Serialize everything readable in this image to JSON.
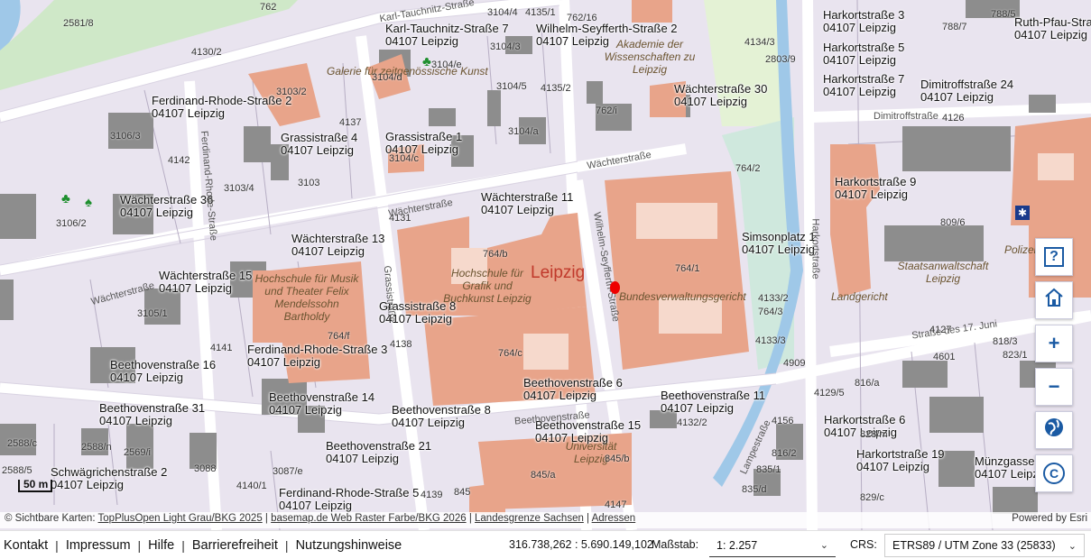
{
  "map": {
    "city_label": "Leipzig",
    "addresses": [
      {
        "street": "Karl-Tauchnitz-Straße 7",
        "zip": "04107 Leipzig"
      },
      {
        "street": "Wilhelm-Seyfferth-Straße 2",
        "zip": "04107 Leipzig"
      },
      {
        "street": "Harkortstraße 3",
        "zip": "04107 Leipzig"
      },
      {
        "street": "Ruth-Pfau-Straße",
        "zip": "04107 Leipzig"
      },
      {
        "street": "Harkortstraße 5",
        "zip": "04107 Leipzig"
      },
      {
        "street": "Harkortstraße 7",
        "zip": "04107 Leipzig"
      },
      {
        "street": "Dimitroffstraße 24",
        "zip": "04107 Leipzig"
      },
      {
        "street": "Ferdinand-Rhode-Straße 2",
        "zip": "04107 Leipzig"
      },
      {
        "street": "Wächterstraße 30",
        "zip": "04107 Leipzig"
      },
      {
        "street": "Grassistraße 4",
        "zip": "04107 Leipzig"
      },
      {
        "street": "Grassistraße 1",
        "zip": "04107 Leipzig"
      },
      {
        "street": "Harkortstraße 9",
        "zip": "04107 Leipzig"
      },
      {
        "street": "Wächterstraße 36",
        "zip": "04107 Leipzig"
      },
      {
        "street": "Wächterstraße 11",
        "zip": "04107 Leipzig"
      },
      {
        "street": "Simsonplatz 1",
        "zip": "04107 Leipzig"
      },
      {
        "street": "Wächterstraße 13",
        "zip": "04107 Leipzig"
      },
      {
        "street": "Wächterstraße 15",
        "zip": "04107 Leipzig"
      },
      {
        "street": "Grassistraße 8",
        "zip": "04107 Leipzig"
      },
      {
        "street": "Ferdinand-Rhode-Straße 3",
        "zip": "04107 Leipzig"
      },
      {
        "street": "Beethovenstraße 16",
        "zip": "04107 Leipzig"
      },
      {
        "street": "Beethovenstraße 6",
        "zip": "04107 Leipzig"
      },
      {
        "street": "Beethovenstraße 11",
        "zip": "04107 Leipzig"
      },
      {
        "street": "Beethovenstraße 14",
        "zip": "04107 Leipzig"
      },
      {
        "street": "Beethovenstraße 31",
        "zip": "04107 Leipzig"
      },
      {
        "street": "Beethovenstraße 8",
        "zip": "04107 Leipzig"
      },
      {
        "street": "Beethovenstraße 15",
        "zip": "04107 Leipzig"
      },
      {
        "street": "Harkortstraße 6",
        "zip": "04107 Leipzig"
      },
      {
        "street": "Beethovenstraße 21",
        "zip": "04107 Leipzig"
      },
      {
        "street": "Harkortstraße 19",
        "zip": "04107 Leipzig"
      },
      {
        "street": "Schwägrichenstraße 2",
        "zip": "04107 Leipzig"
      },
      {
        "street": "Münzgasse",
        "zip": "04107 Leipzig"
      },
      {
        "street": "Ferdinand-Rhode-Straße 5",
        "zip": "04107 Leipzig"
      }
    ],
    "pois": [
      "Galerie für zeitgenössische Kunst",
      "Akademie der Wissenschaften zu Leipzig",
      "Hochschule für Grafik und Buchkunst Leipzig",
      "Bundesverwaltungsgericht",
      "Hochschule für Musik und Theater Felix Mendelssohn Bartholdy",
      "Staatsanwaltschaft Leipzig",
      "Landgericht",
      "Polizei",
      "Universität Leipzig"
    ],
    "streets": [
      "Karl-Tauchnitz-Straße",
      "Wächterstraße",
      "Wächterstraße",
      "Wächterstraße",
      "Grassistraße",
      "Wilhelm-Seyfferth-Straße",
      "Harkortstraße",
      "Dimitroffstraße",
      "Beethovenstraße",
      "Straße des 17. Juni",
      "Lampestraße",
      "Ferdinand-Rhode-Straße"
    ],
    "parcels": [
      "2581/8",
      "762",
      "3104/4",
      "4135/1",
      "762/16",
      "4130/2",
      "3104/3",
      "3104/e",
      "3104/d",
      "3103/2",
      "4135/2",
      "3104/5",
      "762/i",
      "3106/3",
      "3104/a",
      "3104/c",
      "4142",
      "3103/4",
      "3103",
      "4137",
      "3106/2",
      "4131",
      "764/b",
      "764/1",
      "764/2",
      "4133/2",
      "764/3",
      "4133/3",
      "3105/1",
      "764/f",
      "764/c",
      "4138",
      "4141",
      "4909",
      "4129/5",
      "4132/2",
      "4156",
      "2588/c",
      "2588/5",
      "2588/n",
      "2569/i",
      "3088",
      "4140/1",
      "3087/e",
      "845/a",
      "845/b",
      "845",
      "4139",
      "4147",
      "809/6",
      "4127",
      "4126",
      "4134/3",
      "2803/9",
      "788/7",
      "788/5",
      "4601",
      "816/a",
      "818/3",
      "823/1",
      "816/2",
      "835/1",
      "835/d",
      "828/m",
      "829/c"
    ],
    "marker": "selected location"
  },
  "scalebar": {
    "label": "50 m"
  },
  "attribution": {
    "prefix": "© Sichtbare Karten:",
    "sources": [
      "TopPlusOpen Light Grau/BKG 2025",
      "basemap.de Web Raster Farbe/BKG 2026",
      "Landesgrenze Sachsen",
      "Adressen"
    ],
    "powered": "Powered by Esri"
  },
  "controls": [
    {
      "name": "help-button",
      "icon": "help-icon",
      "glyph": "?"
    },
    {
      "name": "home-button",
      "icon": "home-icon",
      "glyph": ""
    },
    {
      "name": "zoom-in-button",
      "icon": "plus-icon",
      "glyph": "+"
    },
    {
      "name": "zoom-out-button",
      "icon": "minus-icon",
      "glyph": "−"
    },
    {
      "name": "basemap-button",
      "icon": "globe-icon",
      "glyph": ""
    },
    {
      "name": "copyright-button",
      "icon": "copyright-icon",
      "glyph": "©"
    }
  ],
  "footer": {
    "links": [
      "Kontakt",
      "Impressum",
      "Hilfe",
      "Barrierefreiheit",
      "Nutzungshinweise"
    ],
    "coordinates": "316.738,262 : 5.690.149,102",
    "scale_label": "Maßstab:",
    "scale_value": "1: 2.257",
    "crs_label": "CRS:",
    "crs_value": "ETRS89 / UTM Zone 33 (25833)"
  },
  "colors": {
    "building": "#e8a48a",
    "building_gray": "#8a8a8a",
    "background": "#e9e4ef",
    "park": "#cfe8c8",
    "water": "#9fc8e8",
    "accent": "#1a5aa3",
    "marker": "#ee0000"
  }
}
